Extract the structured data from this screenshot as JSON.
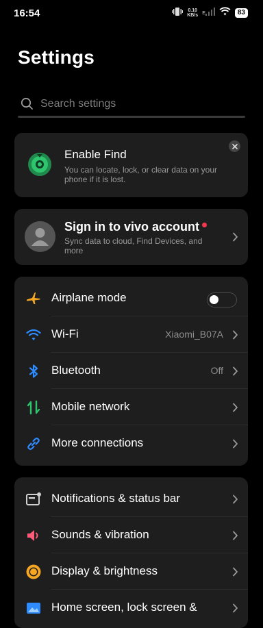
{
  "status_bar": {
    "time": "16:54",
    "net_speed_value": "0.10",
    "net_speed_unit": "KB/s",
    "network_type": "E",
    "battery": "83"
  },
  "page": {
    "title": "Settings"
  },
  "search": {
    "placeholder": "Search settings"
  },
  "find_card": {
    "title": "Enable Find",
    "description": "You can locate, lock, or clear data on your phone if it is lost."
  },
  "account_card": {
    "title": "Sign in to vivo account",
    "description": "Sync data to cloud, Find Devices, and more"
  },
  "connectivity": {
    "airplane": {
      "label": "Airplane mode",
      "enabled": false
    },
    "wifi": {
      "label": "Wi-Fi",
      "value": "Xiaomi_B07A"
    },
    "bluetooth": {
      "label": "Bluetooth",
      "value": "Off"
    },
    "mobile": {
      "label": "Mobile network"
    },
    "more": {
      "label": "More connections"
    }
  },
  "device": {
    "notifications": {
      "label": "Notifications & status bar"
    },
    "sounds": {
      "label": "Sounds & vibration"
    },
    "display": {
      "label": "Display & brightness"
    },
    "home": {
      "label": "Home screen, lock screen &"
    }
  },
  "colors": {
    "accent_blue": "#2e8cff",
    "airplane_orange": "#f5a623",
    "mobile_green": "#2fc46e",
    "sound_pink": "#ff5c7a",
    "display_orange": "#f5a623",
    "badge_red": "#f0384f",
    "card_bg": "#1e1e1e"
  }
}
